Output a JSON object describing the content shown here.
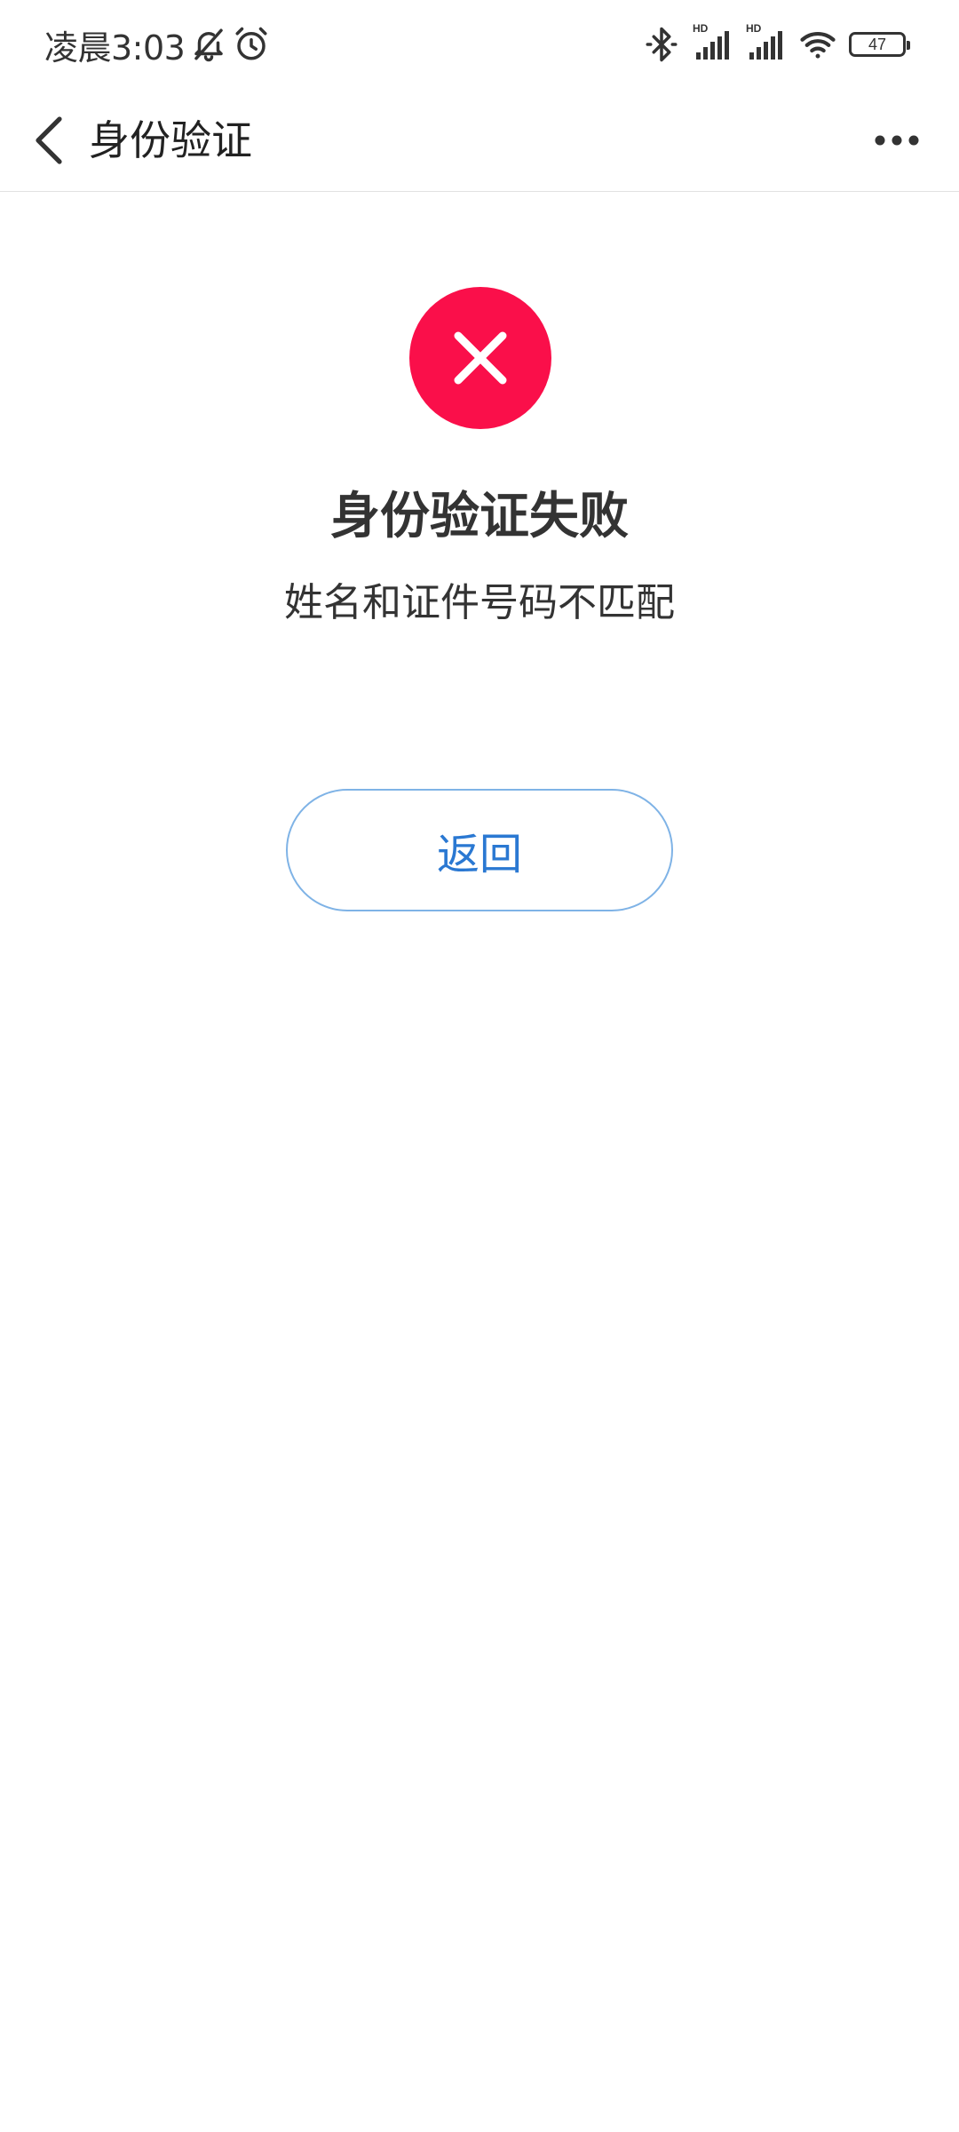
{
  "status_bar": {
    "time": "凌晨3:03",
    "icons": [
      "bell-off-icon",
      "alarm-icon",
      "bluetooth-icon",
      "signal-hd-icon",
      "signal-hd-icon",
      "wifi-icon",
      "battery-icon"
    ],
    "hd_label": "HD",
    "battery_level": "47"
  },
  "nav": {
    "title": "身份验证",
    "back_icon": "chevron-left-icon",
    "more_icon": "more-horizontal-icon"
  },
  "result": {
    "status": "error",
    "icon": "error-circle-x-icon",
    "icon_color": "#fa0f4a",
    "title": "身份验证失败",
    "message": "姓名和证件号码不匹配"
  },
  "actions": {
    "back_label": "返回",
    "accent_color": "#2a78d2"
  }
}
